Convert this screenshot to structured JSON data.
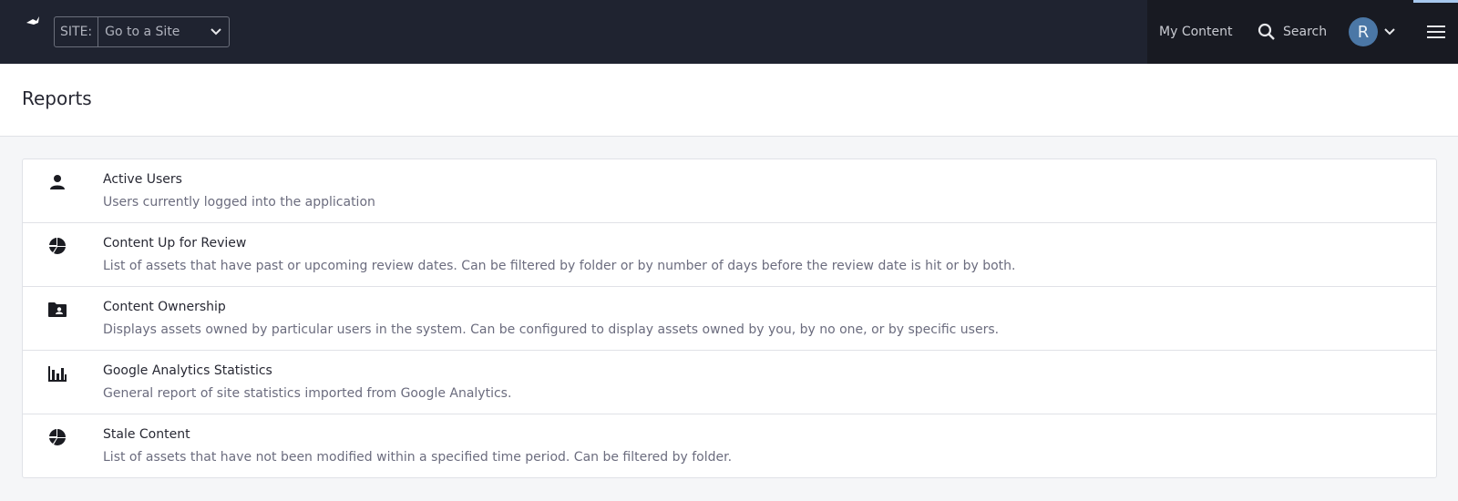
{
  "topbar": {
    "logo": "liferay-logo-icon",
    "site_selector": {
      "label": "SITE:",
      "value": "Go to a Site"
    },
    "nav": {
      "my_content": "My Content",
      "search": "Search"
    },
    "user": {
      "avatar_initial": "R"
    },
    "colors": {
      "bar": "#1f2330",
      "avatar": "#4b77a6",
      "accent": "#a7c8ee"
    }
  },
  "page": {
    "title": "Reports"
  },
  "reports": [
    {
      "icon": "user-icon",
      "title": "Active Users",
      "description": "Users currently logged into the application"
    },
    {
      "icon": "pie-chart-icon",
      "title": "Content Up for Review",
      "description": "List of assets that have past or upcoming review dates. Can be filtered by folder or by number of days before the review date is hit or by both."
    },
    {
      "icon": "folder-user-icon",
      "title": "Content Ownership",
      "description": "Displays assets owned by particular users in the system. Can be configured to display assets owned by you, by no one, or by specific users."
    },
    {
      "icon": "bar-chart-icon",
      "title": "Google Analytics Statistics",
      "description": "General report of site statistics imported from Google Analytics."
    },
    {
      "icon": "pie-chart-icon",
      "title": "Stale Content",
      "description": "List of assets that have not been modified within a specified time period. Can be filtered by folder."
    }
  ]
}
